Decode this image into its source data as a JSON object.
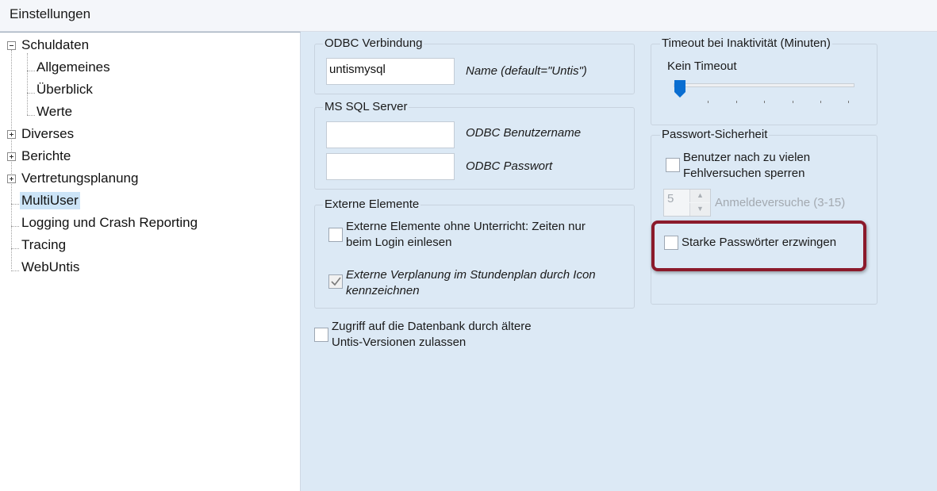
{
  "window": {
    "title": "Einstellungen"
  },
  "tree": {
    "items": [
      {
        "label": "Schuldaten"
      },
      {
        "label": "Allgemeines"
      },
      {
        "label": "Überblick"
      },
      {
        "label": "Werte"
      },
      {
        "label": "Diverses"
      },
      {
        "label": "Berichte"
      },
      {
        "label": "Vertretungsplanung"
      },
      {
        "label": "MultiUser"
      },
      {
        "label": "Logging und Crash Reporting"
      },
      {
        "label": "Tracing"
      },
      {
        "label": "WebUntis"
      }
    ]
  },
  "odbc": {
    "title": "ODBC Verbindung",
    "name_value": "untismysql",
    "name_label": "Name (default=\"Untis\")"
  },
  "mssql": {
    "title": "MS SQL Server",
    "user_value": "",
    "user_label": "ODBC Benutzername",
    "pass_value": "",
    "pass_label": "ODBC Passwort"
  },
  "external": {
    "title": "Externe Elemente",
    "opt1_line1": "Externe Elemente ohne Unterricht: Zeiten nur",
    "opt1_line2": "beim Login einlesen",
    "opt2_line1": "Externe Verplanung im Stundenplan durch Icon",
    "opt2_line2": "kennzeichnen"
  },
  "legacy": {
    "line1": "Zugriff auf die Datenbank durch ältere",
    "line2": "Untis-Versionen zulassen"
  },
  "timeout": {
    "title": "Timeout bei Inaktivität (Minuten)",
    "value_label": "Kein Timeout",
    "slider_position": 0
  },
  "password": {
    "title": "Passwort-Sicherheit",
    "lock_line1": "Benutzer nach zu vielen",
    "lock_line2": "Fehlversuchen sperren",
    "attempts_value": "5",
    "attempts_label": "Anmeldeversuche (3-15)",
    "strong_label": "Starke Passwörter erzwingen"
  },
  "colors": {
    "highlight": "#8b1a2b",
    "accent": "#0a6ed1",
    "panel_bg": "#dce9f5"
  }
}
